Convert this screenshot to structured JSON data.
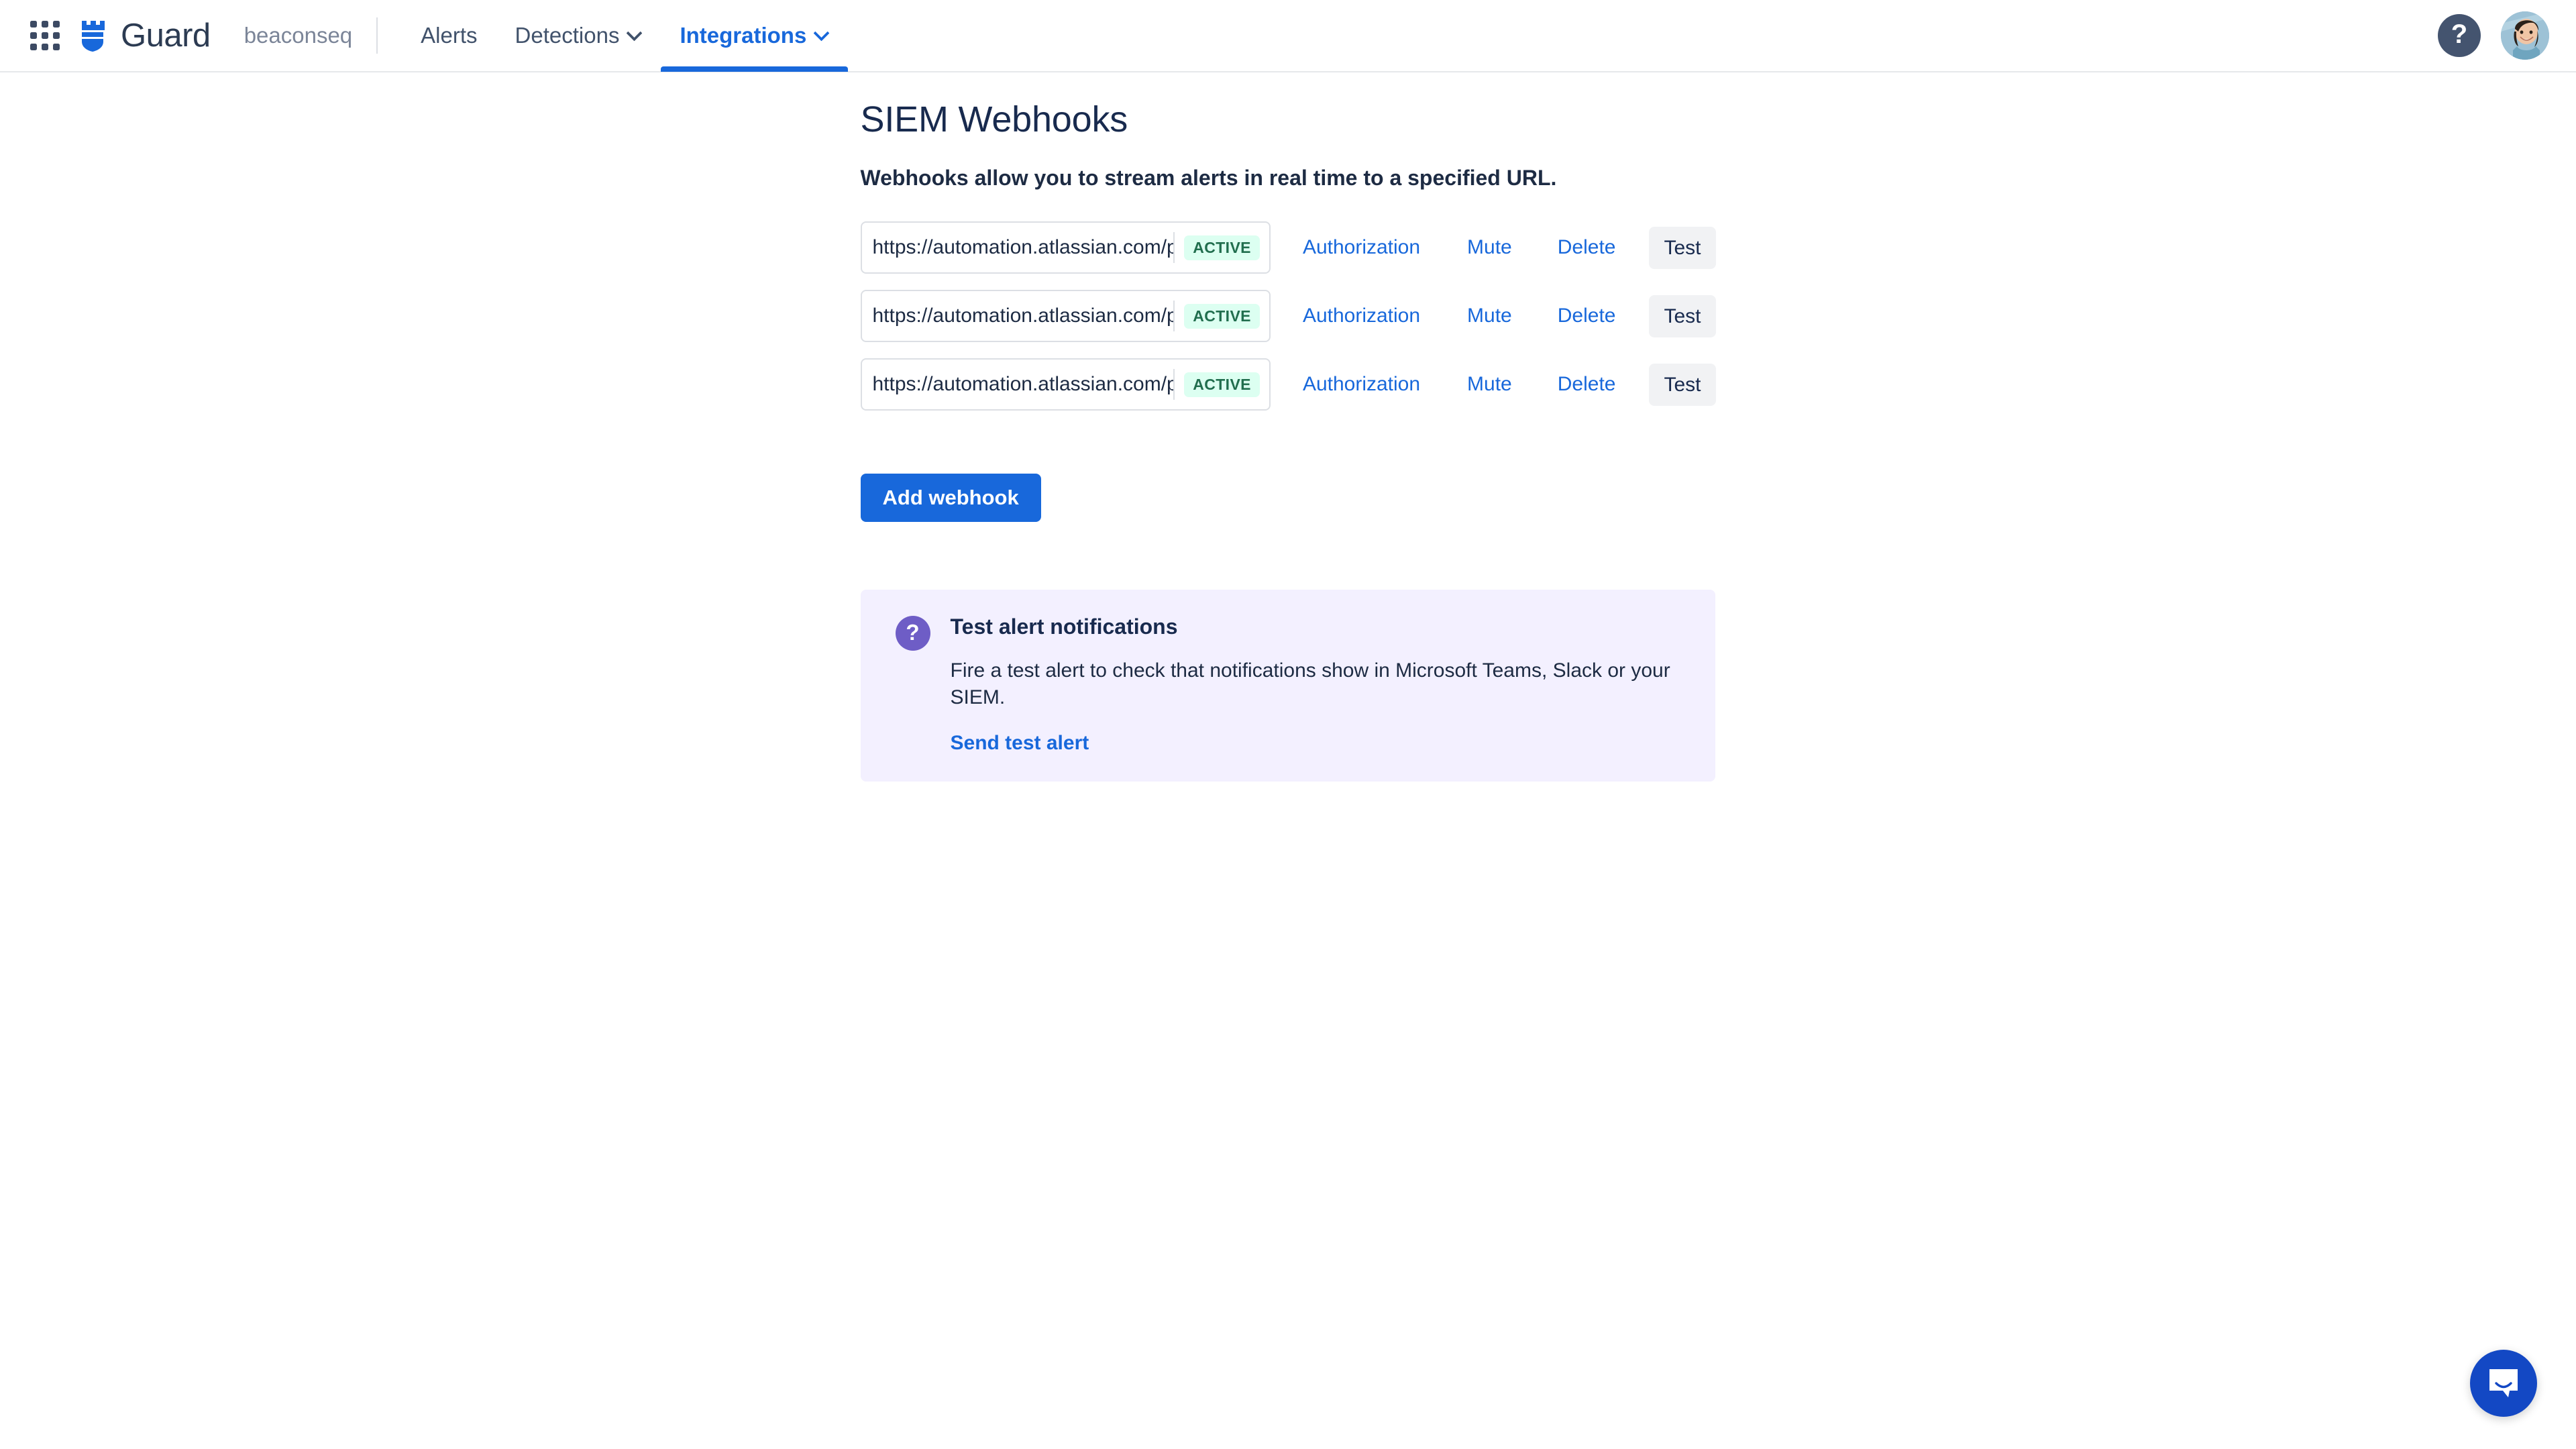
{
  "nav": {
    "app_switcher_icon": "app-switcher-grid-icon",
    "brand_logo_icon": "guard-shield-logo-icon",
    "brand_name": "Guard",
    "tenant": "beaconseq",
    "items": [
      {
        "label": "Alerts",
        "has_chevron": false,
        "active": false
      },
      {
        "label": "Detections",
        "has_chevron": true,
        "active": false
      },
      {
        "label": "Integrations",
        "has_chevron": true,
        "active": true
      }
    ],
    "help_icon": "help-question-icon",
    "help_glyph": "?",
    "avatar_icon": "user-avatar"
  },
  "main": {
    "title": "SIEM Webhooks",
    "subtitle": "Webhooks allow you to stream alerts in real time to a specified URL.",
    "webhooks": [
      {
        "url": "https://automation.atlassian.com/pro",
        "status": "ACTIVE",
        "authorization_label": "Authorization",
        "mute_label": "Mute",
        "delete_label": "Delete",
        "test_label": "Test"
      },
      {
        "url": "https://automation.atlassian.com/pro",
        "status": "ACTIVE",
        "authorization_label": "Authorization",
        "mute_label": "Mute",
        "delete_label": "Delete",
        "test_label": "Test"
      },
      {
        "url": "https://automation.atlassian.com/pro",
        "status": "ACTIVE",
        "authorization_label": "Authorization",
        "mute_label": "Mute",
        "delete_label": "Delete",
        "test_label": "Test"
      }
    ],
    "add_webhook_label": "Add webhook",
    "info_panel": {
      "icon": "question-circle-icon",
      "icon_glyph": "?",
      "title": "Test alert notifications",
      "text": "Fire a test alert to check that notifications show in Microsoft Teams, Slack or your SIEM.",
      "link_label": "Send test alert"
    }
  },
  "widgets": {
    "intercom_icon": "intercom-chat-bubble-icon"
  },
  "colors": {
    "accent_blue": "#1868db",
    "badge_bg": "#dcfff1",
    "badge_text": "#216e4e",
    "panel_bg": "#f3f0ff",
    "panel_icon": "#6e5dc6",
    "text_dark": "#182a4e",
    "intercom_blue": "#1348c4"
  }
}
